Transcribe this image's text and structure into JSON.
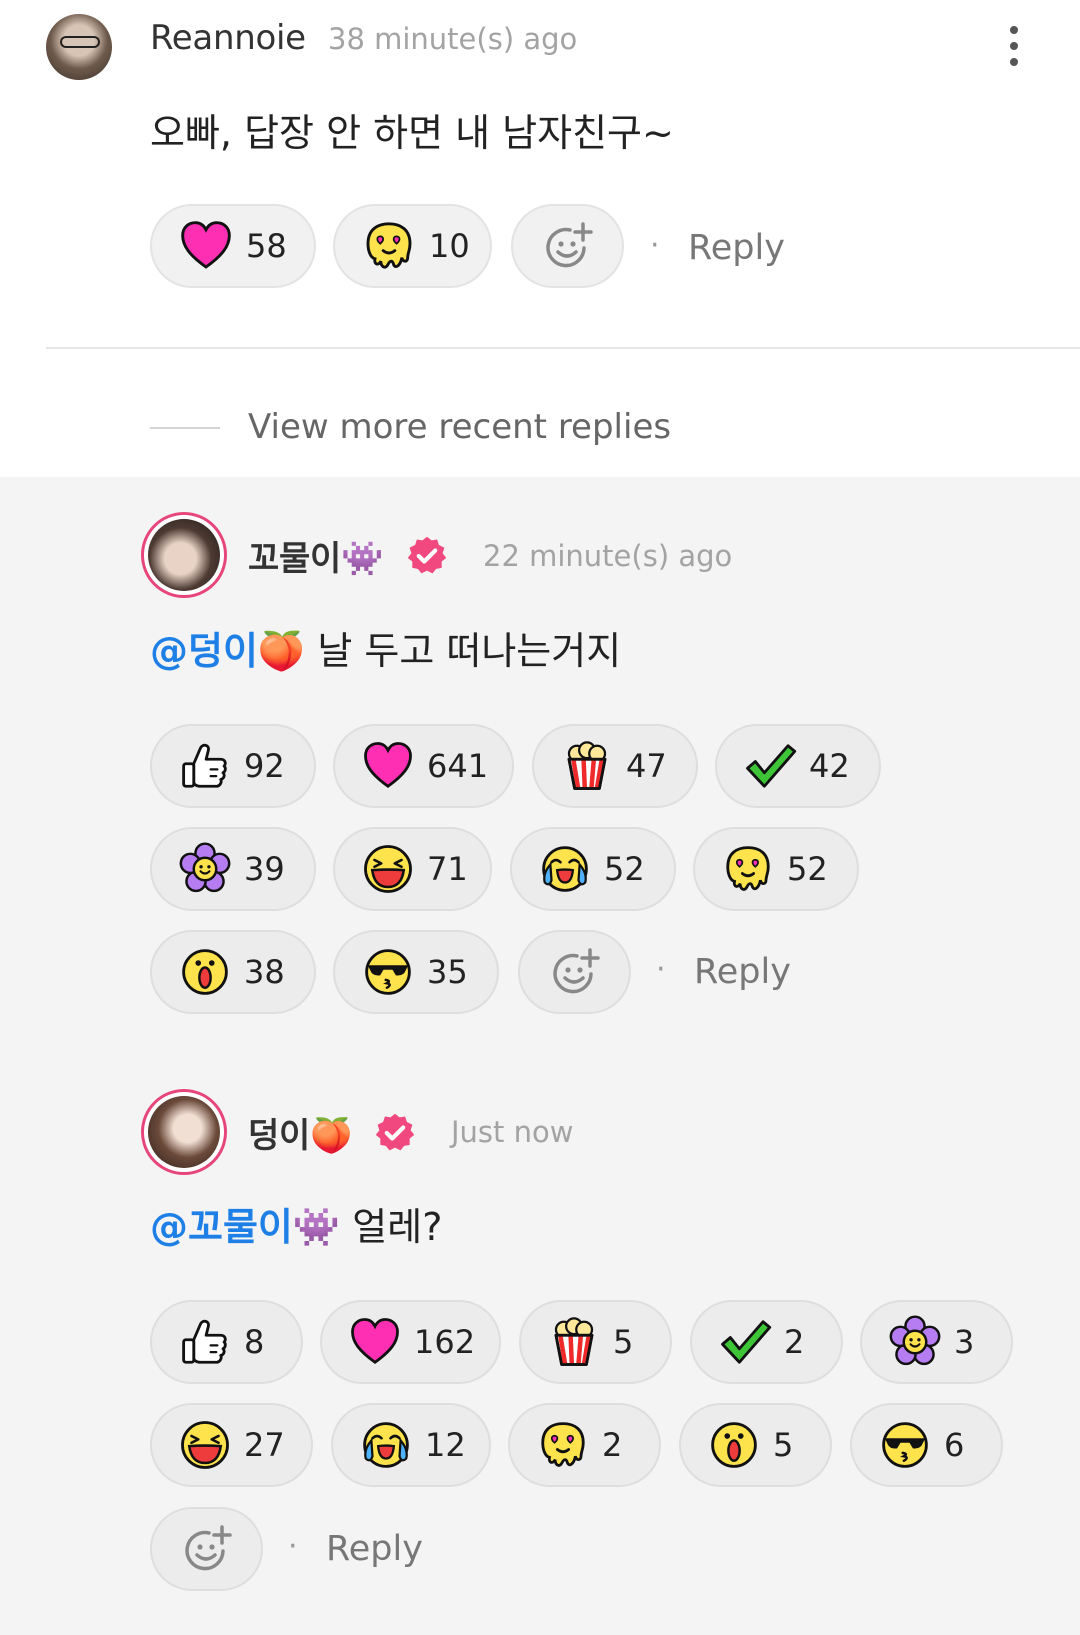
{
  "comment": {
    "username": "Reannoie",
    "time": "38 minute(s) ago",
    "text": "오빠, 답장 안 하면 내 남자친구~",
    "reactions": [
      {
        "icon": "heart-icon",
        "count": "58"
      },
      {
        "icon": "love-melt-icon",
        "count": "10"
      }
    ],
    "reply_label": "Reply"
  },
  "view_more_label": "View more recent replies",
  "reply1": {
    "username": "꼬물이",
    "username_emoji": "👾",
    "time": "22 minute(s) ago",
    "mention": "@덩이🍑",
    "text": "날 두고 떠나는거지",
    "reactions": [
      {
        "icon": "thumbs-up-icon",
        "count": "92"
      },
      {
        "icon": "heart-icon",
        "count": "641"
      },
      {
        "icon": "popcorn-icon",
        "count": "47"
      },
      {
        "icon": "check-icon",
        "count": "42"
      },
      {
        "icon": "flower-icon",
        "count": "39"
      },
      {
        "icon": "laugh-icon",
        "count": "71"
      },
      {
        "icon": "crying-laugh-icon",
        "count": "52"
      },
      {
        "icon": "love-melt-icon",
        "count": "52"
      },
      {
        "icon": "surprised-icon",
        "count": "38"
      },
      {
        "icon": "cool-kiss-icon",
        "count": "35"
      }
    ],
    "reply_label": "Reply"
  },
  "reply2": {
    "username": "덩이",
    "username_emoji": "🍑",
    "time": "Just now",
    "mention": "@꼬물이👾",
    "text": "얼레?",
    "reactions": [
      {
        "icon": "thumbs-up-icon",
        "count": "8"
      },
      {
        "icon": "heart-icon",
        "count": "162"
      },
      {
        "icon": "popcorn-icon",
        "count": "5"
      },
      {
        "icon": "check-icon",
        "count": "2"
      },
      {
        "icon": "flower-icon",
        "count": "3"
      },
      {
        "icon": "laugh-icon",
        "count": "27"
      },
      {
        "icon": "crying-laugh-icon",
        "count": "12"
      },
      {
        "icon": "love-melt-icon",
        "count": "2"
      },
      {
        "icon": "surprised-icon",
        "count": "5"
      },
      {
        "icon": "cool-kiss-icon",
        "count": "6"
      }
    ],
    "reply_label": "Reply"
  },
  "colors": {
    "heart": "#ff2fb4",
    "mention": "#1e7fe6",
    "verified": "#f0487f",
    "reaction_yellow": "#ffe34d",
    "check": "#3ec437",
    "flower": "#b67cf2"
  }
}
